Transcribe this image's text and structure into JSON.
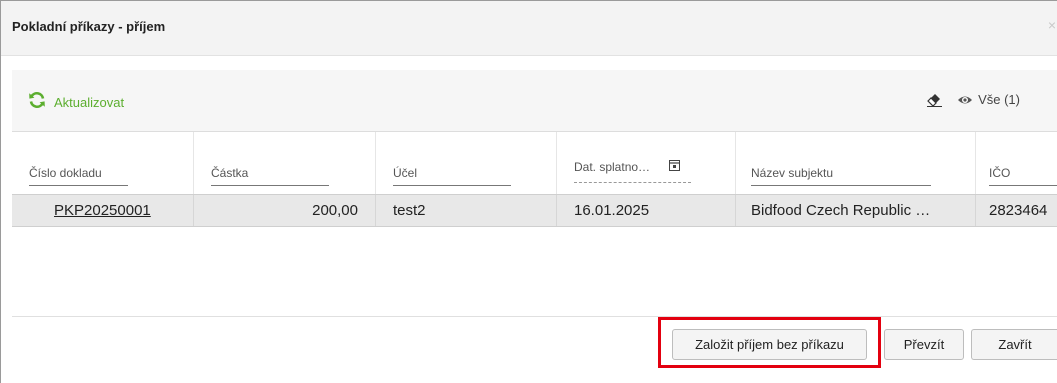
{
  "dialog": {
    "title": "Pokladní příkazy - příjem",
    "close_glyph": "×"
  },
  "toolbar": {
    "refresh_label": "Aktualizovat",
    "refresh_icon": "refresh-icon",
    "eraser_icon": "eraser-icon",
    "eye_icon": "eye-icon",
    "filter_label": "Vše (1)",
    "accent_color": "#5cae2f"
  },
  "table": {
    "columns": [
      "Číslo dokladu",
      "Částka",
      "Účel",
      "Dat. splatno…",
      "Název subjektu",
      "IČO"
    ],
    "rows": [
      {
        "cislo": "PKP20250001",
        "castka": "200,00",
        "ucel": "test2",
        "datum": "16.01.2025",
        "nazev": "Bidfood Czech Republic …",
        "ico": "2823464"
      }
    ]
  },
  "footer": {
    "create_label": "Založit příjem bez příkazu",
    "take_label": "Převzít",
    "close_label": "Zavřít",
    "highlight_color": "#e3000f"
  }
}
